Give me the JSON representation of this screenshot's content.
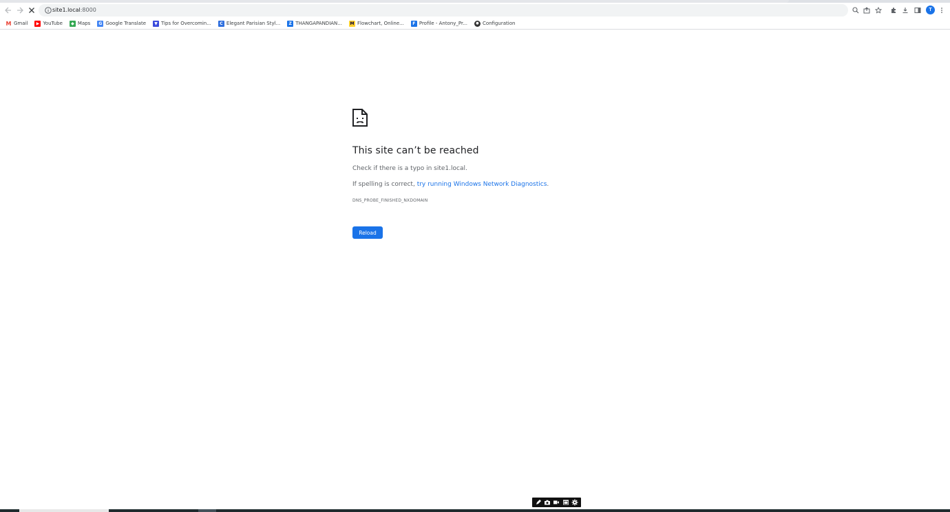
{
  "browser": {
    "url_host": "site1.local",
    "url_port": ":8000",
    "profile_initial": "T"
  },
  "bookmarks": [
    {
      "label": "Gmail",
      "icon": "gmail-icon",
      "color": "#ea4335",
      "glyph": "M"
    },
    {
      "label": "YouTube",
      "icon": "youtube-icon",
      "color": "#ff0000",
      "glyph": "▶"
    },
    {
      "label": "Maps",
      "icon": "maps-icon",
      "color": "#34a853",
      "glyph": "◆"
    },
    {
      "label": "Google Translate",
      "icon": "translate-icon",
      "color": "#4285f4",
      "glyph": "G"
    },
    {
      "label": "Tips for Overcomin...",
      "icon": "bookmark-icon",
      "color": "#3b4bdc",
      "glyph": "▼"
    },
    {
      "label": "Elegant Parisian Styl...",
      "icon": "canva-icon",
      "color": "#2f6fde",
      "glyph": "C"
    },
    {
      "label": "THANGAPANDIAN...",
      "icon": "zoho-icon",
      "color": "#1a73e8",
      "glyph": "Z"
    },
    {
      "label": "Flowchart, Online...",
      "icon": "miro-icon",
      "color": "#ffd02f",
      "glyph": "M"
    },
    {
      "label": "Profile - Antony_Pr...",
      "icon": "profile-icon",
      "color": "#1a73e8",
      "glyph": "F"
    },
    {
      "label": "Configuration",
      "icon": "github-icon",
      "color": "#333333",
      "glyph": "●"
    }
  ],
  "error": {
    "title": "This site can’t be reached",
    "line1": "Check if there is a typo in site1.local.",
    "line2_prefix": "If spelling is correct, ",
    "line2_link": "try running Windows Network Diagnostics",
    "line2_suffix": ".",
    "code": "DNS_PROBE_FINISHED_NXDOMAIN",
    "reload_label": "Reload"
  },
  "colors": {
    "accent": "#1a73e8",
    "text_secondary": "#5f6368"
  }
}
